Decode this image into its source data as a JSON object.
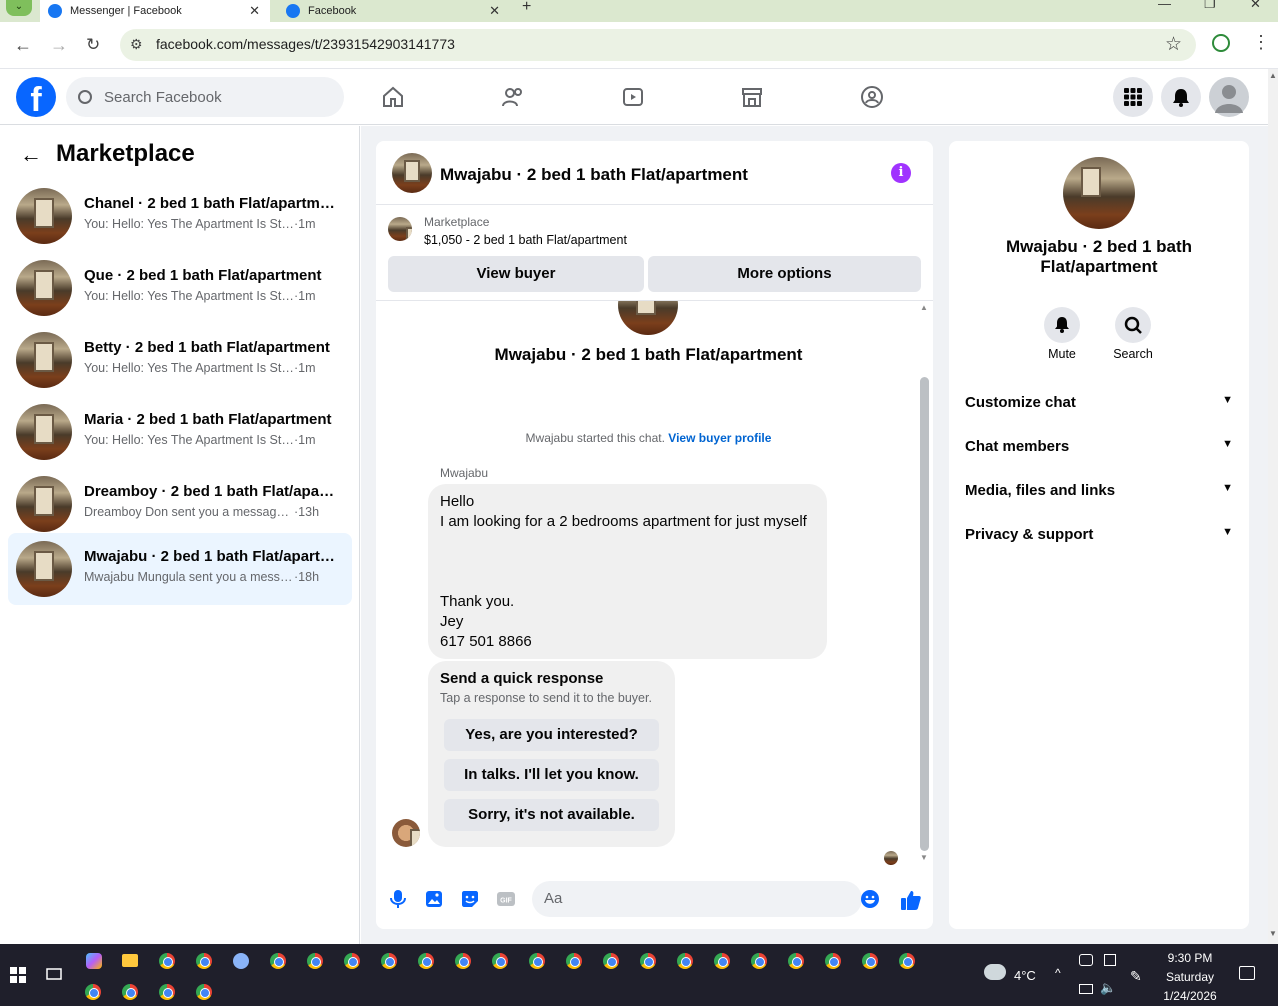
{
  "browser": {
    "tabs": [
      {
        "title": "Messenger | Facebook"
      },
      {
        "title": "Facebook"
      }
    ],
    "url": "facebook.com/messages/t/23931542903141773"
  },
  "header": {
    "search_placeholder": "Search Facebook"
  },
  "left_pane": {
    "title": "Marketplace",
    "conversations": [
      {
        "name": "Chanel · 2 bed 1 bath Flat/apartment",
        "preview": "You: Hello: Yes The Apartment Is Still ...",
        "time": "·1m"
      },
      {
        "name": "Que · 2 bed 1 bath Flat/apartment",
        "preview": "You: Hello: Yes The Apartment Is Still ...",
        "time": "·1m"
      },
      {
        "name": "Betty · 2 bed 1 bath Flat/apartment",
        "preview": "You: Hello: Yes The Apartment Is Still ...",
        "time": "·1m"
      },
      {
        "name": "Maria · 2 bed 1 bath Flat/apartment",
        "preview": "You: Hello: Yes The Apartment Is Still ...",
        "time": "·1m"
      },
      {
        "name": "Dreamboy · 2 bed 1 bath Flat/apartment",
        "preview": "Dreamboy Don sent you a message ...",
        "time": "·13h"
      },
      {
        "name": "Mwajabu · 2 bed 1 bath Flat/apartment",
        "preview": "Mwajabu Mungula sent you a messa...",
        "time": "·18h"
      }
    ]
  },
  "chat": {
    "title": "Mwajabu · 2 bed 1 bath Flat/apartment",
    "marketplace_label": "Marketplace",
    "listing": "$1,050 - 2 bed 1 bath Flat/apartment",
    "view_buyer": "View buyer",
    "more_options": "More options",
    "conversation_title": "Mwajabu · 2 bed 1 bath Flat/apartment",
    "started_text": "Mwajabu started this chat.",
    "view_buyer_profile": "View buyer profile",
    "sender": "Mwajabu",
    "message": "Hello\nI am looking for a 2 bedrooms apartment for just myself\n\n\n\nThank you.\nJey\n617 501 8866",
    "quick_title": "Send a quick response",
    "quick_sub": "Tap a response to send it to the buyer.",
    "quick_responses": [
      "Yes, are you interested?",
      "In talks. I'll let you know.",
      "Sorry, it's not available."
    ],
    "composer_placeholder": "Aa"
  },
  "right_pane": {
    "name": "Mwajabu · 2 bed 1 bath Flat/apartment",
    "mute": "Mute",
    "search": "Search",
    "rows": [
      "Customize chat",
      "Chat members",
      "Media, files and links",
      "Privacy & support"
    ]
  },
  "taskbar": {
    "temperature": "4°C",
    "time": "9:30 PM",
    "day": "Saturday",
    "date": "1/24/2026"
  },
  "colors": {
    "brand": "#0866ff",
    "info": "#a033ff",
    "active_row": "#ebf5ff"
  }
}
